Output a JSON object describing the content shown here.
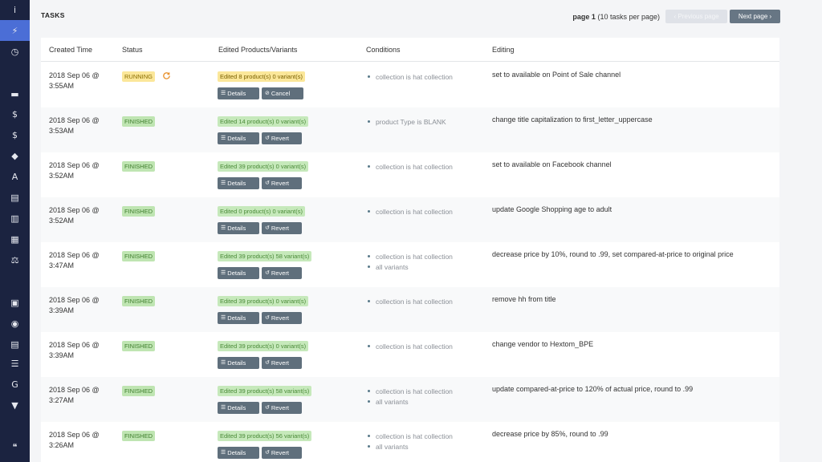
{
  "sidebar": {
    "items": [
      {
        "name": "info-icon",
        "glyph": "i",
        "active": false
      },
      {
        "name": "lightning-icon",
        "glyph": "⚡",
        "active": true
      },
      {
        "name": "clock-icon",
        "glyph": "◷",
        "active": false
      },
      {
        "name": "truck-icon",
        "glyph": "▬",
        "active": false
      },
      {
        "name": "dollar-icon",
        "glyph": "$",
        "active": false
      },
      {
        "name": "strikethrough-dollar-icon",
        "glyph": "$",
        "active": false
      },
      {
        "name": "tag-icon",
        "glyph": "◆",
        "active": false
      },
      {
        "name": "font-icon",
        "glyph": "A",
        "active": false
      },
      {
        "name": "file-icon",
        "glyph": "▤",
        "active": false
      },
      {
        "name": "barcode-icon",
        "glyph": "▥",
        "active": false
      },
      {
        "name": "building-icon",
        "glyph": "▦",
        "active": false
      },
      {
        "name": "balance-icon",
        "glyph": "⚖",
        "active": false
      },
      {
        "name": "box-icon",
        "glyph": "▣",
        "active": false
      },
      {
        "name": "eye-icon",
        "glyph": "◉",
        "active": false
      },
      {
        "name": "document-icon",
        "glyph": "▤",
        "active": false
      },
      {
        "name": "list-icon",
        "glyph": "☰",
        "active": false
      },
      {
        "name": "google-icon",
        "glyph": "G",
        "active": false
      },
      {
        "name": "filter-icon",
        "glyph": "▼",
        "active": false
      },
      {
        "name": "quote-icon",
        "glyph": "❝",
        "active": false
      }
    ]
  },
  "header": {
    "title": "TASKS",
    "page_label": "page 1",
    "page_meta": "(10 tasks per page)",
    "prev_label": "‹ Previous page",
    "next_label": "Next page ›"
  },
  "table": {
    "columns": [
      "Created Time",
      "Status",
      "Edited Products/Variants",
      "Conditions",
      "Editing"
    ],
    "details_label": "Details",
    "cancel_label": "Cancel",
    "revert_label": "Revert",
    "rows": [
      {
        "time1": "2018 Sep 06 @",
        "time2": "3:55AM",
        "status": "RUNNING",
        "edited": "Edited 8 product(s) 0 variant(s)",
        "conditions": [
          "collection is hat collection"
        ],
        "editing": "set to available on Point of Sale channel"
      },
      {
        "time1": "2018 Sep 06 @",
        "time2": "3:53AM",
        "status": "FINISHED",
        "edited": "Edited 14 product(s) 0 variant(s)",
        "conditions": [
          "product Type is BLANK"
        ],
        "editing": "change title capitalization to first_letter_uppercase"
      },
      {
        "time1": "2018 Sep 06 @",
        "time2": "3:52AM",
        "status": "FINISHED",
        "edited": "Edited 39 product(s) 0 variant(s)",
        "conditions": [
          "collection is hat collection"
        ],
        "editing": "set to available on Facebook channel"
      },
      {
        "time1": "2018 Sep 06 @",
        "time2": "3:52AM",
        "status": "FINISHED",
        "edited": "Edited 0 product(s) 0 variant(s)",
        "conditions": [
          "collection is hat collection"
        ],
        "editing": "update Google Shopping age to adult"
      },
      {
        "time1": "2018 Sep 06 @",
        "time2": "3:47AM",
        "status": "FINISHED",
        "edited": "Edited 39 product(s) 58 variant(s)",
        "conditions": [
          "collection is hat collection",
          "all variants"
        ],
        "editing": "decrease price by 10%, round to .99, set compared-at-price to original price"
      },
      {
        "time1": "2018 Sep 06 @",
        "time2": "3:39AM",
        "status": "FINISHED",
        "edited": "Edited 39 product(s) 0 variant(s)",
        "conditions": [
          "collection is hat collection"
        ],
        "editing": "remove hh from title"
      },
      {
        "time1": "2018 Sep 06 @",
        "time2": "3:39AM",
        "status": "FINISHED",
        "edited": "Edited 39 product(s) 0 variant(s)",
        "conditions": [
          "collection is hat collection"
        ],
        "editing": "change vendor to Hextom_BPE"
      },
      {
        "time1": "2018 Sep 06 @",
        "time2": "3:27AM",
        "status": "FINISHED",
        "edited": "Edited 39 product(s) 58 variant(s)",
        "conditions": [
          "collection is hat collection",
          "all variants"
        ],
        "editing": "update compared-at-price to 120% of actual price, round to .99"
      },
      {
        "time1": "2018 Sep 06 @",
        "time2": "3:26AM",
        "status": "FINISHED",
        "edited": "Edited 39 product(s) 56 variant(s)",
        "conditions": [
          "collection is hat collection",
          "all variants"
        ],
        "editing": "decrease price by 85%, round to .99"
      }
    ]
  },
  "colors": {
    "sidebar": "#1b2340",
    "active": "#4b6ed6",
    "running": "#fbe79a",
    "finished": "#bfe5b2",
    "button": "#5f6f7c"
  }
}
